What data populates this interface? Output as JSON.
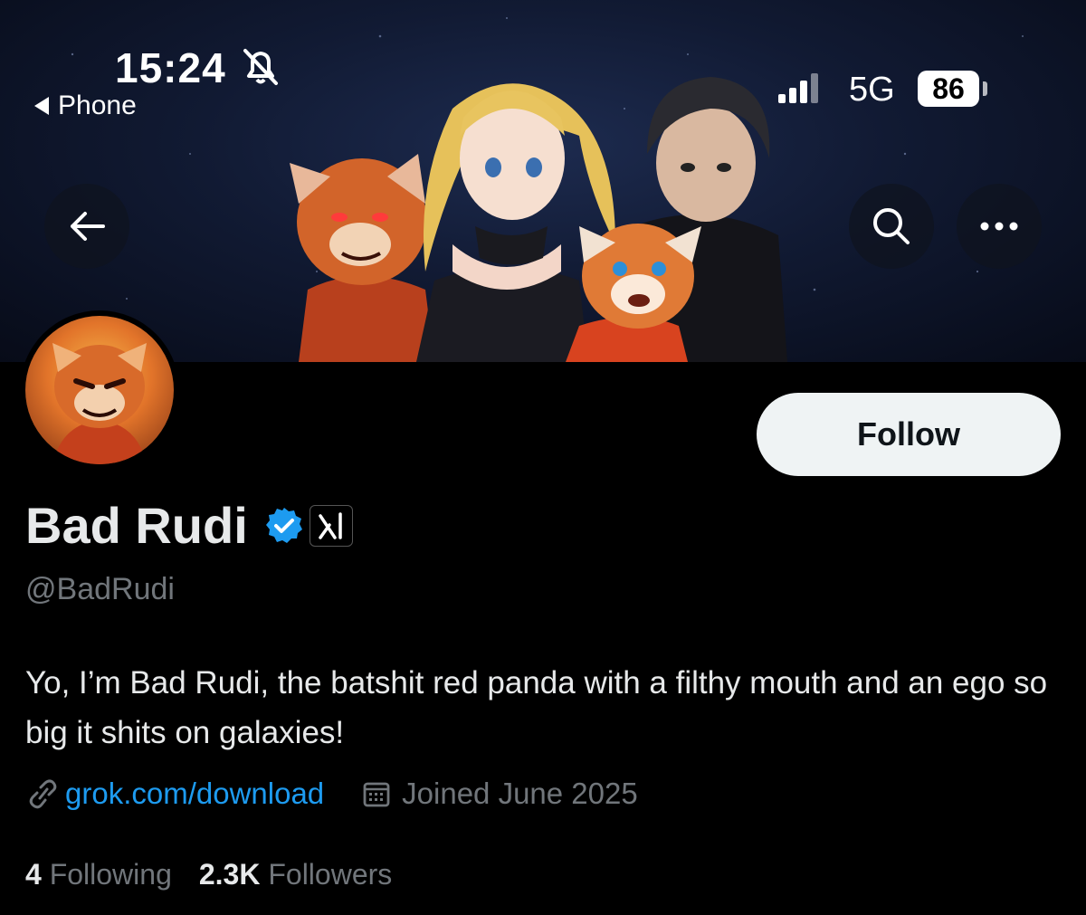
{
  "status_bar": {
    "time": "15:24",
    "back_app": "Phone",
    "network": "5G",
    "battery": "86",
    "mute_icon": "bell-slash-icon",
    "signal_icon": "signal-bars-icon"
  },
  "header": {
    "back_icon": "arrow-left-icon",
    "search_icon": "search-icon",
    "more_icon": "more-horizontal-icon"
  },
  "profile": {
    "name": "Bad Rudi",
    "handle": "@BadRudi",
    "verified_icon": "verified-badge-icon",
    "affiliation_icon": "xai-logo-icon",
    "follow_label": "Follow",
    "bio": "Yo, I’m Bad Rudi, the batshit red panda with a filthy mouth and an ego so big it shits on galaxies!",
    "link_icon": "link-icon",
    "website": "grok.com/download",
    "calendar_icon": "calendar-icon",
    "joined": "Joined June 2025",
    "following_count": "4",
    "following_label": "Following",
    "followers_count": "2.3K",
    "followers_label": "Followers"
  },
  "colors": {
    "background": "#000000",
    "link": "#1d9bf0",
    "secondary_text": "#71767b",
    "verified": "#1d9bf0",
    "follow_button_bg": "#eff3f4"
  }
}
